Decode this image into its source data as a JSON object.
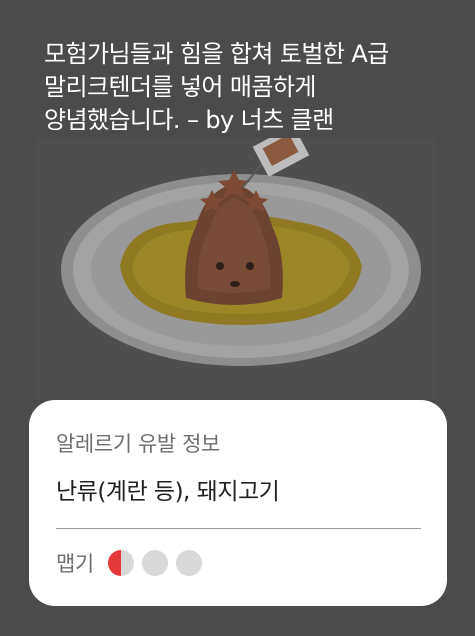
{
  "menu": {
    "description": "모험가님들과 힘을 합쳐 토벌한 A급 말리크텐더를 넣어 매콤하게 양념했습니다. – by 너츠 클랜"
  },
  "allergy": {
    "title": "알레르기 유발 정보",
    "value": "난류(계란 등), 돼지고기"
  },
  "spicy": {
    "label": "맵기",
    "level": 0.5,
    "max": 3,
    "active_color": "#e5393c",
    "inactive_color": "#d9d9d9"
  },
  "colors": {
    "background": "#4b4b4b",
    "card": "#ffffff",
    "rice": "#e8c11a"
  }
}
